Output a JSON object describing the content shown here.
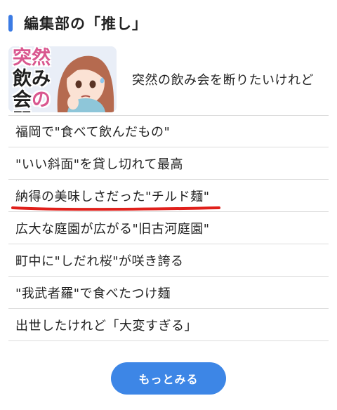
{
  "section": {
    "title": "編集部の「推し」"
  },
  "feature": {
    "thumbnail_text": [
      "突然",
      "の",
      "飲み会",
      "問"
    ],
    "title": "突然の飲み会を断りたいけれど"
  },
  "articles": [
    "福岡で\"食べて飲んだもの\"",
    "\"いい斜面\"を貸し切れて最高",
    "納得の美味しさだった\"チルド麺\"",
    "広大な庭園が広がる\"旧古河庭園\"",
    "町中に\"しだれ桜\"が咲き誇る",
    "\"我武者羅\"で食べたつけ麺",
    "出世したけれど「大変すぎる」"
  ],
  "more_button": {
    "label": "もっとみる"
  },
  "colors": {
    "accent_bar": "#3b7be4",
    "button": "#3d86e6",
    "underline": "#e0201b",
    "thumbnail_accent": "#d9578f"
  }
}
